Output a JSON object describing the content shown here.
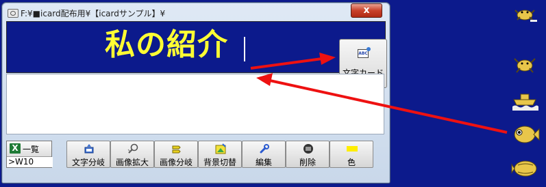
{
  "window": {
    "title": "F:¥■icard配布用¥【icardサンプル】¥",
    "close_label": "x"
  },
  "display": {
    "text": "私の紹介"
  },
  "moji_card_button": {
    "label": "文字カード",
    "icon": "text-card-icon",
    "icon_text": "ABC"
  },
  "bottom": {
    "ichiran": {
      "label": "一覧",
      "icon_text": "X",
      "icon": "excel-icon"
    },
    "w10_value": ">W10"
  },
  "tools": [
    {
      "label": "文字分岐",
      "icon": "text-branch-icon"
    },
    {
      "label": "画像拡大",
      "icon": "image-zoom-icon"
    },
    {
      "label": "画像分岐",
      "icon": "image-branch-icon"
    },
    {
      "label": "背景切替",
      "icon": "background-switch-icon"
    },
    {
      "label": "編集",
      "icon": "edit-wrench-icon"
    },
    {
      "label": "削除",
      "icon": "delete-icon"
    },
    {
      "label": "色",
      "icon": "color-swatch-icon"
    }
  ],
  "desktop_icons": [
    {
      "icon": "crab-icon"
    },
    {
      "icon": "crab-icon"
    },
    {
      "icon": "boat-icon"
    },
    {
      "icon": "fish-icon"
    },
    {
      "icon": "flatfish-icon"
    }
  ],
  "colors": {
    "desktop_bg": "#0c1a8c",
    "display_text": "#ffff33",
    "annotation_arrow": "#ee1111",
    "close_button": "#c8412a"
  }
}
